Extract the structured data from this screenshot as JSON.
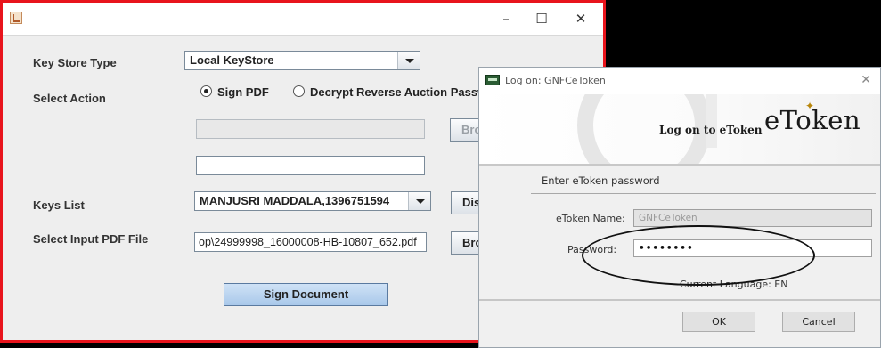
{
  "main_window": {
    "controls": {
      "minimize": "–",
      "maximize": "☐",
      "close": "✕"
    },
    "key_store_type": {
      "label": "Key Store Type",
      "value": "Local KeyStore"
    },
    "select_action": {
      "label": "Select Action",
      "options": [
        "Sign PDF",
        "Decrypt Reverse Auction Passwo"
      ],
      "selected": "Sign PDF"
    },
    "browse_disabled_label": "Bro",
    "keys_list": {
      "label": "Keys List",
      "value": "MANJUSRI MADDALA,1396751594",
      "button_label": "Dis"
    },
    "input_pdf": {
      "label": "Select Input PDF File",
      "value": "op\\24999998_16000008-HB-10807_652.pdf",
      "button_label": "Bro"
    },
    "sign_button": "Sign Document"
  },
  "dialog": {
    "title": "Log on: GNFCeToken",
    "close": "✕",
    "banner_heading": "Log on to eToken",
    "logo_text": "eToken",
    "section_label": "Enter eToken password",
    "token_name": {
      "label": "eToken Name:",
      "value": "GNFCeToken"
    },
    "password": {
      "label": "Password:",
      "value": "••••••••"
    },
    "language": "Current Language: EN",
    "ok_label": "OK",
    "cancel_label": "Cancel"
  },
  "colors": {
    "highlight_border": "#e8141c",
    "primary_button": "#b9d4f0"
  },
  "icons": [
    "java-app-icon",
    "etoken-icon",
    "radio-selected-icon",
    "dropdown-arrow-icon"
  ]
}
